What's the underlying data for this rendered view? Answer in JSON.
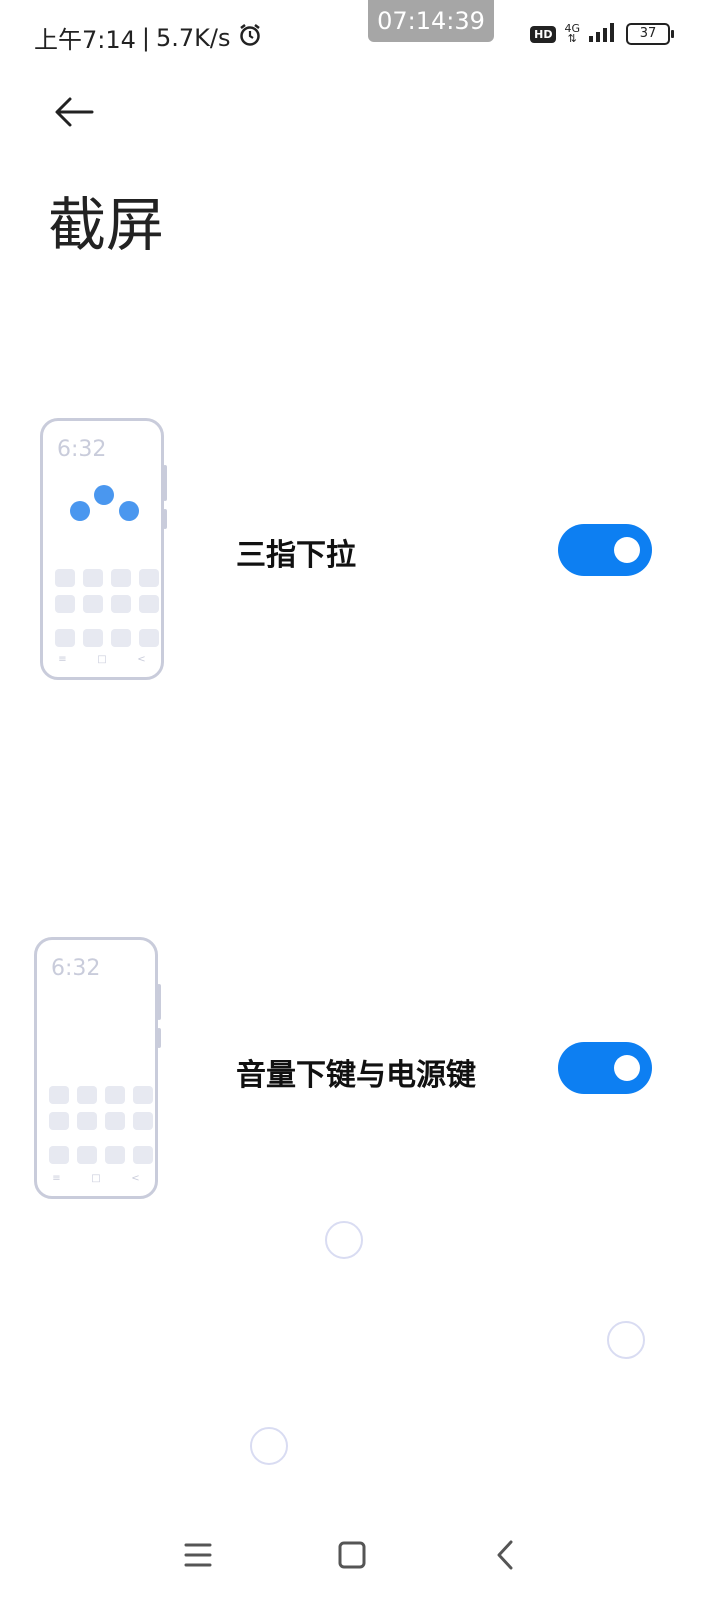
{
  "status_bar": {
    "time_left": "上午7:14",
    "separator": "|",
    "net_speed": "5.7K/s",
    "clock_overlay": "07:14:39",
    "hd": "HD",
    "network": "4G",
    "battery": "37"
  },
  "header": {
    "title": "截屏"
  },
  "settings": [
    {
      "label": "三指下拉",
      "enabled": true,
      "illustration_clock": "6:32"
    },
    {
      "label": "音量下键与电源键",
      "enabled": true,
      "illustration_clock": "6:32"
    }
  ],
  "illustration_nav": {
    "menu": "≡",
    "home": "□",
    "back": "<"
  },
  "nav_bar": {
    "menu": "menu-icon",
    "home": "home-icon",
    "back": "back-icon"
  },
  "colors": {
    "accent": "#0d7ff2",
    "illustration_stroke": "#c9ccdb",
    "dot": "#4a97ef"
  }
}
